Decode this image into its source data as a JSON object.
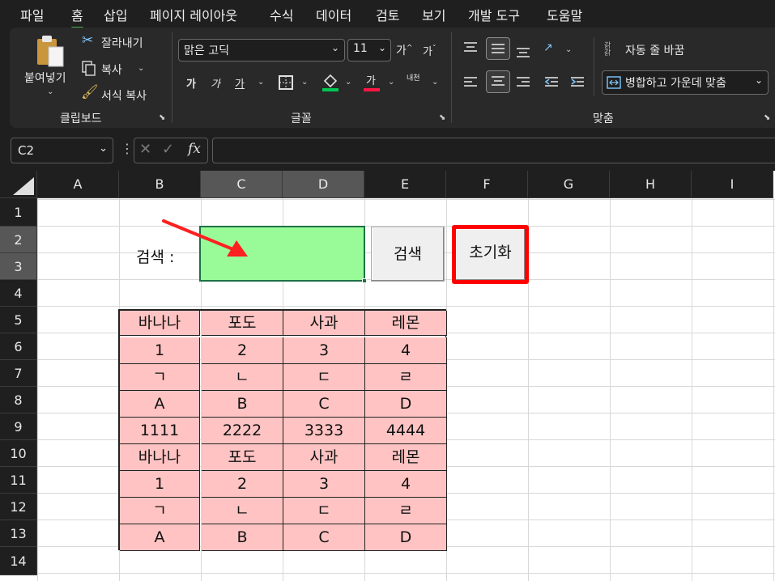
{
  "menu": {
    "file": "파일",
    "home": "홈",
    "insert": "삽입",
    "page_layout": "페이지 레이아웃",
    "formulas": "수식",
    "data": "데이터",
    "review": "검토",
    "view": "보기",
    "developer": "개발 도구",
    "help": "도움말"
  },
  "ribbon": {
    "clipboard": {
      "paste_label": "붙여넣기",
      "cut_label": "잘라내기",
      "copy_label": "복사",
      "format_painter_label": "서식 복사",
      "group_label": "클립보드"
    },
    "font": {
      "font_name": "맑은 고딕",
      "font_size": "11",
      "grow_font": "가",
      "shrink_font": "가",
      "bold": "가",
      "italic": "가",
      "underline": "가",
      "font_color_glyph": "가",
      "phonetic_top": "내천",
      "group_label": "글꼴"
    },
    "alignment": {
      "wrap_text_label": "자동 줄 바꿈",
      "merge_center_label": "병합하고 가운데 맞춤",
      "group_label": "맞춤"
    },
    "colors": {
      "fill_color": "#00c853",
      "font_color": "#ff1744",
      "accent_green": "#4caf50"
    }
  },
  "formula_bar": {
    "name_box": "C2",
    "fx_label": "fx",
    "formula_value": ""
  },
  "sheet": {
    "columns": [
      "A",
      "B",
      "C",
      "D",
      "E",
      "F",
      "G",
      "H",
      "I"
    ],
    "selected_columns": [
      "C",
      "D"
    ],
    "rows": [
      "1",
      "2",
      "3",
      "4",
      "5",
      "6",
      "7",
      "8",
      "9",
      "10",
      "11",
      "12",
      "13",
      "14"
    ],
    "selected_rows": [
      "2",
      "3"
    ],
    "search_label": "검색 :",
    "search_input_value": "",
    "search_input_color": "#98fb98",
    "search_button": "검색",
    "reset_button": "초기화",
    "reset_highlight_color": "#ff0000",
    "table_fill_color": "#ffc3c3",
    "table": [
      [
        "바나나",
        "포도",
        "사과",
        "레몬"
      ],
      [
        "1",
        "2",
        "3",
        "4"
      ],
      [
        "ㄱ",
        "ㄴ",
        "ㄷ",
        "ㄹ"
      ],
      [
        "A",
        "B",
        "C",
        "D"
      ],
      [
        "1111",
        "2222",
        "3333",
        "4444"
      ],
      [
        "바나나",
        "포도",
        "사과",
        "레몬"
      ],
      [
        "1",
        "2",
        "3",
        "4"
      ],
      [
        "ㄱ",
        "ㄴ",
        "ㄷ",
        "ㄹ"
      ],
      [
        "A",
        "B",
        "C",
        "D"
      ]
    ]
  }
}
